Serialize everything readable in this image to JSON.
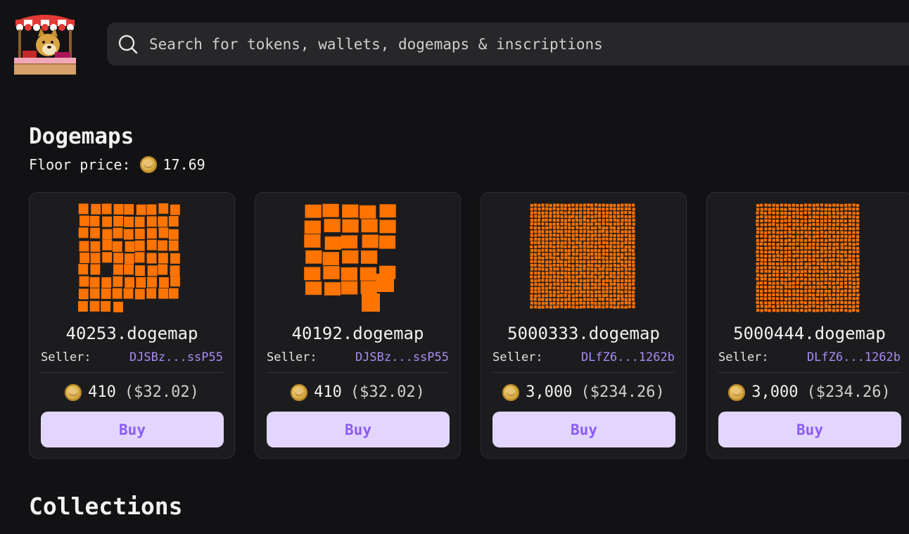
{
  "header": {
    "search_placeholder": "Search for tokens, wallets, dogemaps & inscriptions"
  },
  "dogemaps": {
    "title": "Dogemaps",
    "floor_label": "Floor price:",
    "floor_value": "17.69"
  },
  "cards": [
    {
      "name": "40253.dogemap",
      "seller_label": "Seller:",
      "seller": "DJSBz...ssP55",
      "price": "410",
      "price_usd": "($32.02)",
      "buy_label": "Buy"
    },
    {
      "name": "40192.dogemap",
      "seller_label": "Seller:",
      "seller": "DJSBz...ssP55",
      "price": "410",
      "price_usd": "($32.02)",
      "buy_label": "Buy"
    },
    {
      "name": "5000333.dogemap",
      "seller_label": "Seller:",
      "seller": "DLfZ6...1262b",
      "price": "3,000",
      "price_usd": "($234.26)",
      "buy_label": "Buy"
    },
    {
      "name": "5000444.dogemap",
      "seller_label": "Seller:",
      "seller": "DLfZ6...1262b",
      "price": "3,000",
      "price_usd": "($234.26)",
      "buy_label": "Buy"
    }
  ],
  "collections": {
    "title": "Collections"
  },
  "colors": {
    "background": "#121214",
    "card": "#1c1c1f",
    "accent": "#8b5cf6",
    "buy_bg": "#e3d6fe",
    "dogemap_tile": "#ff7300"
  },
  "icons": {
    "logo": "doge-shop-stall-logo",
    "search": "search-icon",
    "coin": "dogecoin-icon"
  }
}
